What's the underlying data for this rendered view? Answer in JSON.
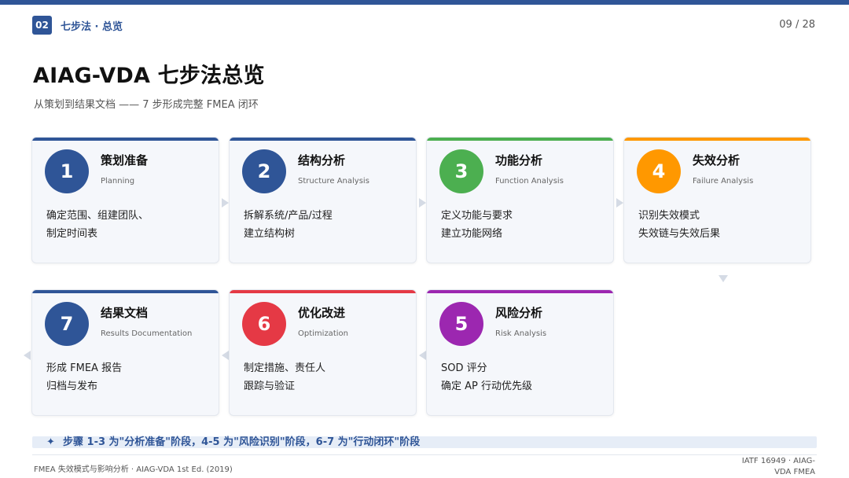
{
  "header": {
    "section_number": "02",
    "section_title": "七步法 · 总览",
    "page_number": "09 / 28"
  },
  "title": "AIAG-VDA 七步法总览",
  "subtitle": "从策划到结果文档 —— 7 步形成完整 FMEA 闭环",
  "colors": {
    "brand": "#2f5597",
    "step_blue": "#2f5597",
    "step_green": "#4caf50",
    "step_orange": "#ff9800",
    "step_red": "#e53945",
    "step_purple": "#9c27b0",
    "card_bg": "#f5f7fb"
  },
  "steps": [
    {
      "number": "1",
      "title": "策划准备",
      "english": "Planning",
      "desc": [
        "确定范围、组建团队、",
        "制定时间表"
      ],
      "color": "#2f5597"
    },
    {
      "number": "2",
      "title": "结构分析",
      "english": "Structure Analysis",
      "desc": [
        "拆解系统/产品/过程",
        "建立结构树"
      ],
      "color": "#2f5597"
    },
    {
      "number": "3",
      "title": "功能分析",
      "english": "Function Analysis",
      "desc": [
        "定义功能与要求",
        "建立功能网络"
      ],
      "color": "#4caf50"
    },
    {
      "number": "4",
      "title": "失效分析",
      "english": "Failure Analysis",
      "desc": [
        "识别失效模式",
        "失效链与失效后果"
      ],
      "color": "#ff9800"
    },
    {
      "number": "7",
      "title": "结果文档",
      "english": "Results Documentation",
      "desc": [
        "形成 FMEA 报告",
        "归档与发布"
      ],
      "color": "#2f5597"
    },
    {
      "number": "6",
      "title": "优化改进",
      "english": "Optimization",
      "desc": [
        "制定措施、责任人",
        "跟踪与验证"
      ],
      "color": "#e53945"
    },
    {
      "number": "5",
      "title": "风险分析",
      "english": "Risk Analysis",
      "desc": [
        "SOD 评分",
        "确定 AP 行动优先级"
      ],
      "color": "#9c27b0"
    }
  ],
  "note": {
    "icon": "sparkle-icon",
    "text": "步骤 1-3 为\"分析准备\"阶段，4-5 为\"风险识别\"阶段，6-7 为\"行动闭环\"阶段"
  },
  "footer": {
    "left": "FMEA 失效模式与影响分析 · AIAG-VDA 1st Ed. (2019)",
    "right_line1": "IATF 16949 · AIAG-",
    "right_line2": "VDA FMEA"
  }
}
